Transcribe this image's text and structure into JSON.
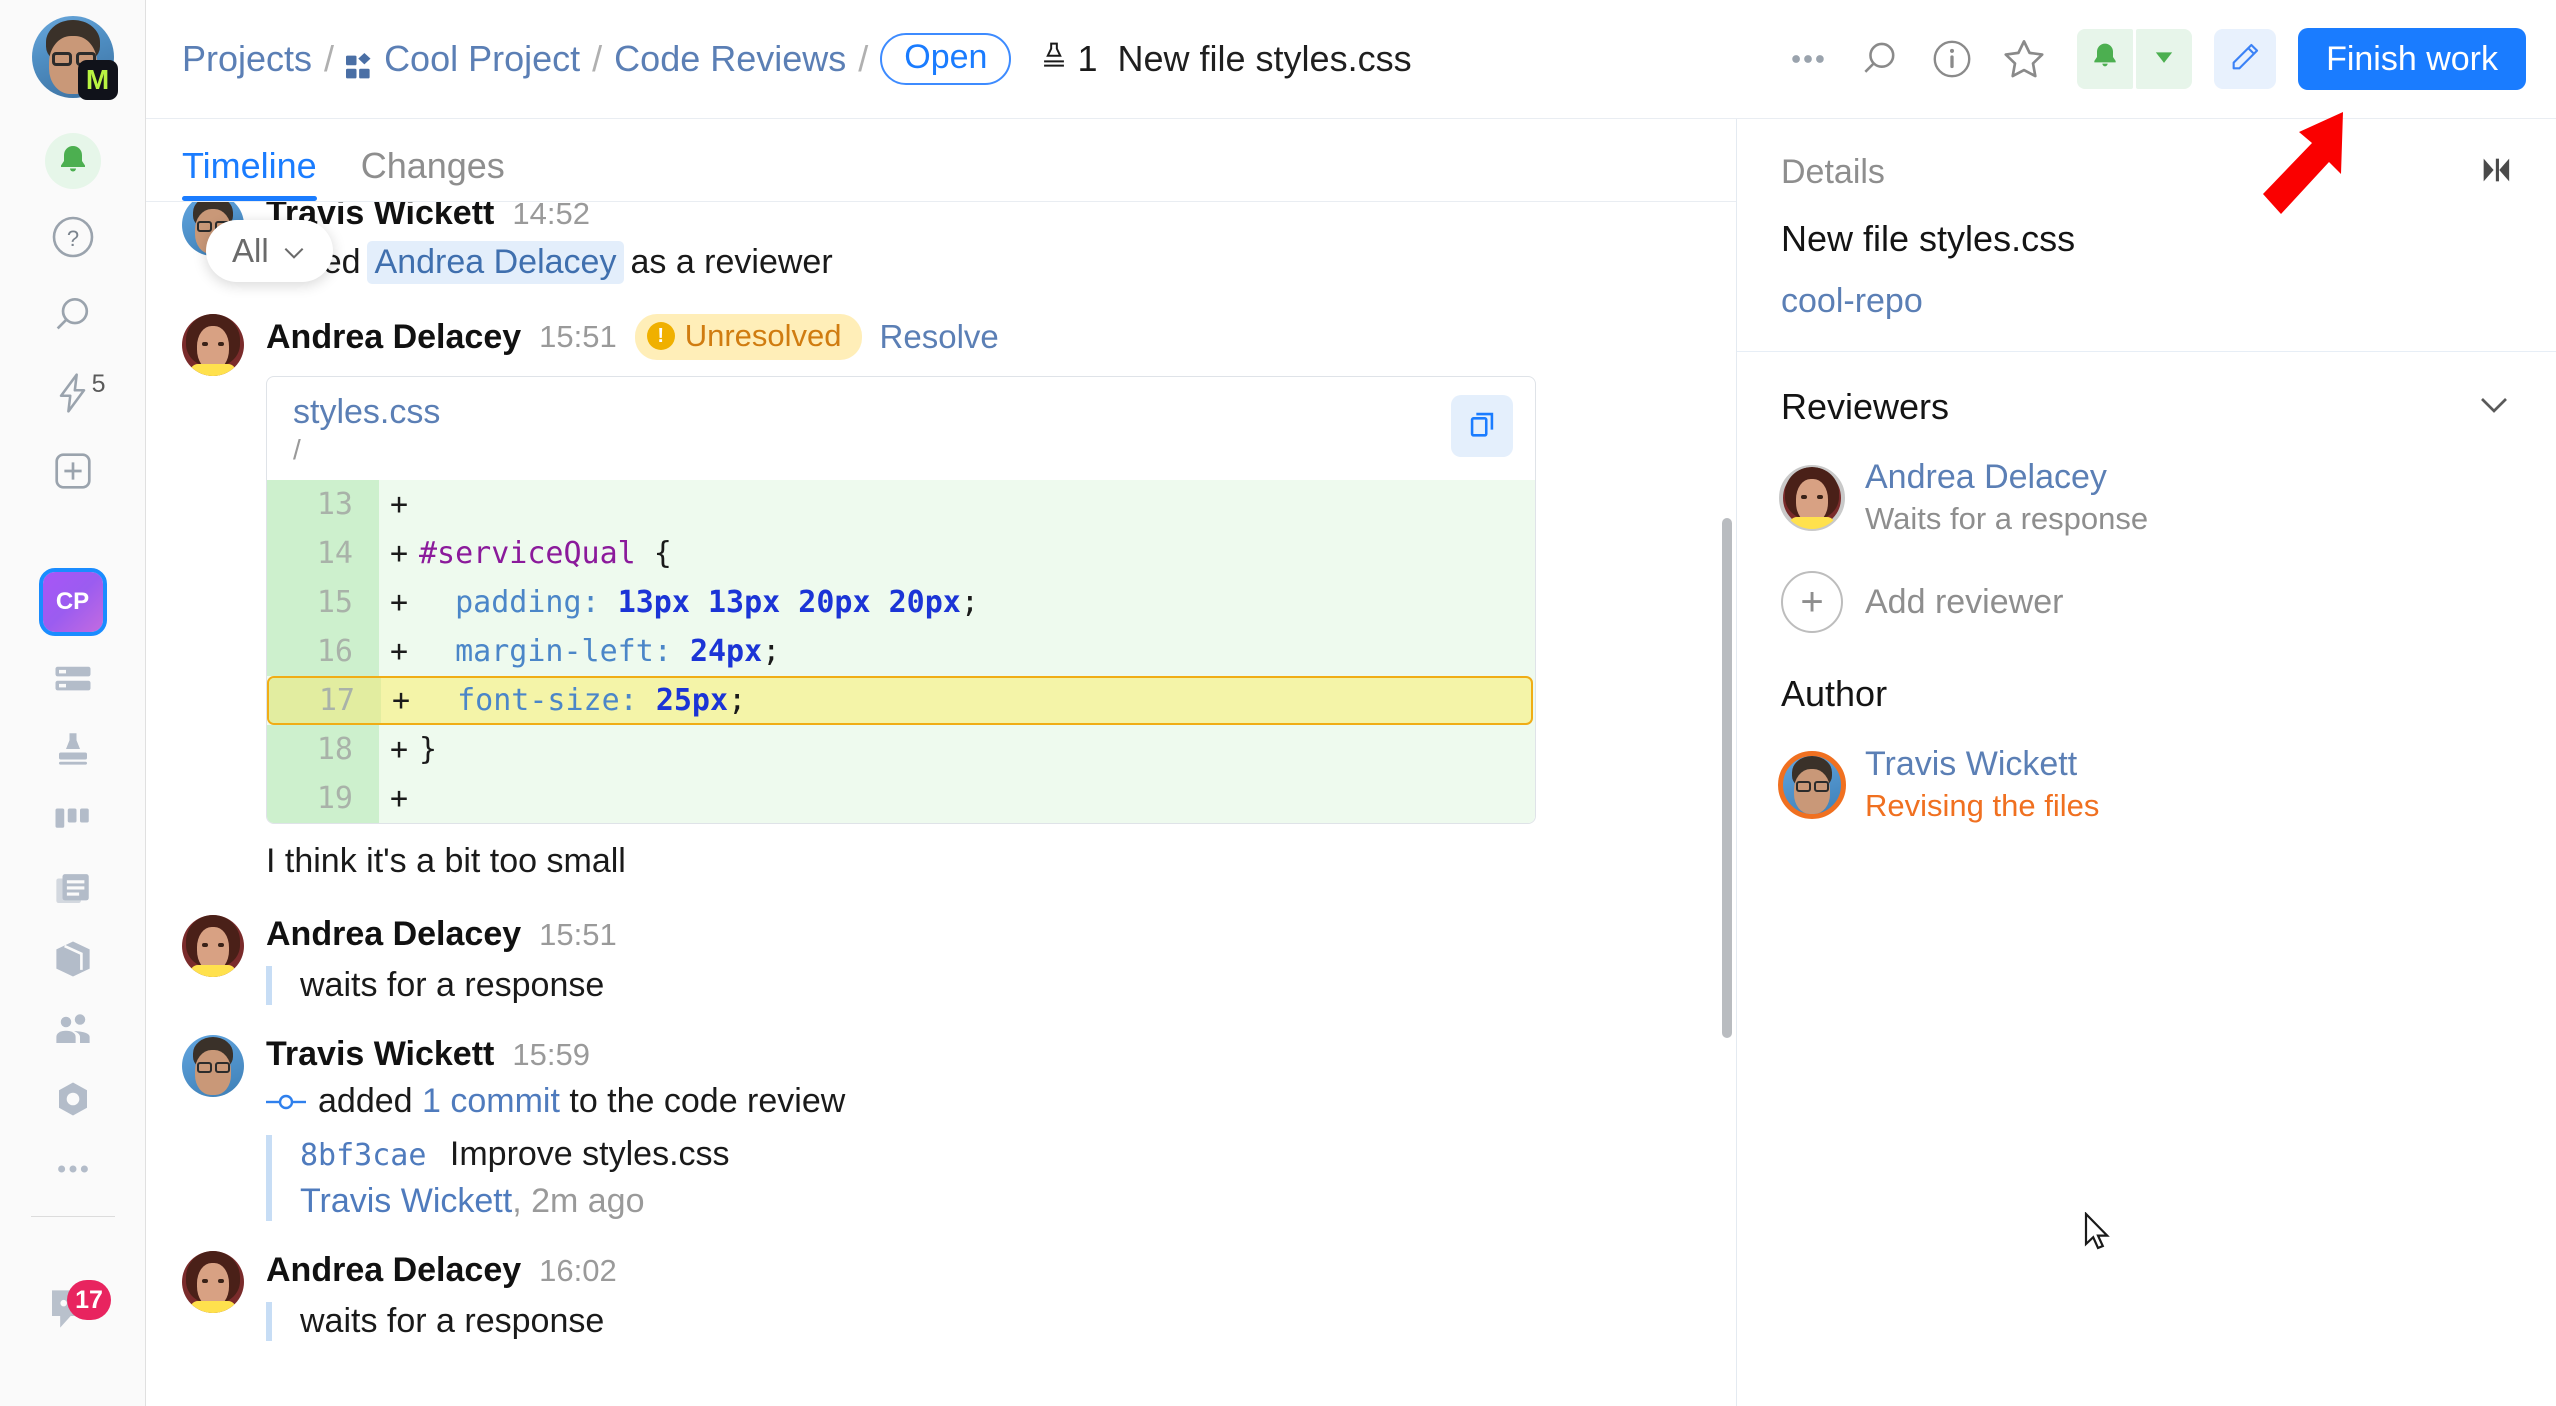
{
  "left_rail": {
    "user_avatar_name": "Travis Wickett",
    "badge_letter": "M",
    "items": [
      {
        "icon": "bell-icon",
        "label": "Notifications"
      },
      {
        "icon": "help-icon",
        "label": "Help"
      },
      {
        "icon": "search-icon",
        "label": "Search"
      },
      {
        "icon": "lightning-icon",
        "label": "Quick actions",
        "count": "5"
      },
      {
        "icon": "plus-square-icon",
        "label": "Create"
      }
    ],
    "project_tile": "CP",
    "project_icons": [
      {
        "icon": "issues-icon",
        "label": "Issues"
      },
      {
        "icon": "stamp-icon",
        "label": "Code Reviews"
      },
      {
        "icon": "board-icon",
        "label": "Agile Boards"
      },
      {
        "icon": "articles-icon",
        "label": "Knowledge Base"
      },
      {
        "icon": "package-icon",
        "label": "Packages"
      },
      {
        "icon": "users-icon",
        "label": "Teams"
      },
      {
        "icon": "nut-icon",
        "label": "Settings"
      },
      {
        "icon": "more-icon",
        "label": "More"
      }
    ],
    "chat": {
      "icon": "chat-icon",
      "badge": "17"
    }
  },
  "topbar": {
    "breadcrumb": {
      "projects": "Projects",
      "project_icon": "project-tiles-icon",
      "project": "Cool Project",
      "section": "Code Reviews",
      "status_pill": "Open"
    },
    "review_icon": "stamp-icon",
    "review_number": "1",
    "review_title": "New file styles.css",
    "actions": [
      {
        "icon": "more-dots-icon",
        "label": "More options"
      },
      {
        "icon": "search-icon",
        "label": "Search"
      },
      {
        "icon": "info-circle-icon",
        "label": "Details"
      },
      {
        "icon": "star-icon",
        "label": "Star"
      }
    ],
    "notify_icon": "bell-icon",
    "notify_dropdown_icon": "caret-down-icon",
    "edit_icon": "pencil-icon",
    "finish_label": "Finish work",
    "finish_color": "#1a7cff"
  },
  "tabs": [
    {
      "label": "Timeline",
      "active": true
    },
    {
      "label": "Changes",
      "active": false
    }
  ],
  "filter_pill": {
    "label": "All",
    "icon": "chevron-down-icon"
  },
  "timeline": {
    "entries": [
      {
        "author": "Travis Wickett",
        "time": "14:52",
        "avatar": "travis",
        "action_prefix": "added",
        "mention": "Andrea Delacey",
        "action_suffix": "as a reviewer"
      },
      {
        "author": "Andrea Delacey",
        "time": "15:51",
        "avatar": "andrea",
        "badge": "Unresolved",
        "badge_icon": "alert-icon",
        "resolve_label": "Resolve",
        "code": {
          "file": "styles.css",
          "path": "/",
          "copy_icon": "copy-icon",
          "lines": [
            {
              "num": "13",
              "marker": "+",
              "text": "",
              "highlight": false
            },
            {
              "num": "14",
              "marker": "+",
              "text": "#serviceQual {",
              "highlight": false
            },
            {
              "num": "15",
              "marker": "+",
              "text": "  padding: 13px 13px 20px 20px;",
              "highlight": false
            },
            {
              "num": "16",
              "marker": "+",
              "text": "  margin-left: 24px;",
              "highlight": false
            },
            {
              "num": "17",
              "marker": "+",
              "text": "  font-size: 25px;",
              "highlight": true
            },
            {
              "num": "18",
              "marker": "+",
              "text": "}",
              "highlight": false
            },
            {
              "num": "19",
              "marker": "+",
              "text": "",
              "highlight": false
            }
          ]
        },
        "comment": "I think it's a bit too small"
      },
      {
        "author": "Andrea Delacey",
        "time": "15:51",
        "avatar": "andrea",
        "quote": "waits for a response"
      },
      {
        "author": "Travis Wickett",
        "time": "15:59",
        "avatar": "travis",
        "commit_icon": "commit-node-icon",
        "action_prefix": "added",
        "commit_link": "1 commit",
        "action_suffix": "to the code review",
        "commit": {
          "hash": "8bf3cae",
          "message": "Improve styles.css",
          "author": "Travis Wickett",
          "when": ", 2m ago"
        }
      },
      {
        "author": "Andrea Delacey",
        "time": "16:02",
        "avatar": "andrea",
        "quote": "waits for a response"
      }
    ]
  },
  "details": {
    "header": "Details",
    "collapse_icon": "collapse-panel-icon",
    "title": "New file styles.css",
    "repo": "cool-repo",
    "reviewers_title": "Reviewers",
    "reviewers_chevron": "chevron-down-icon",
    "reviewers": [
      {
        "name": "Andrea Delacey",
        "status": "Waits for a response",
        "avatar": "andrea",
        "ring": "gray"
      }
    ],
    "add_reviewer": {
      "label": "Add reviewer",
      "icon": "plus-circle-icon"
    },
    "author_title": "Author",
    "author": {
      "name": "Travis Wickett",
      "status": "Revising the files",
      "avatar": "travis",
      "ring": "orange"
    }
  },
  "annotations": {
    "arrow_color": "#fa0000",
    "arrow_target": "Finish work"
  }
}
